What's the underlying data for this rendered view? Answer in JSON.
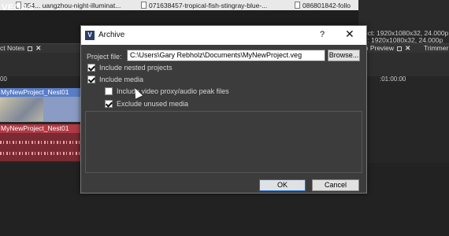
{
  "app": {
    "logo": "VEGAS"
  },
  "file_tabs": [
    {
      "label": "054... uangzhou-night-illuminat..."
    },
    {
      "label": "071638457-tropical-fish-stingray-blue-..."
    },
    {
      "label": "086801842-follo"
    }
  ],
  "properties": {
    "line1": "ect:   1920x1080x32, 24.000p",
    "line2": "lt:    1920x1080x32, 24.000p"
  },
  "panels": {
    "left_tab": "ct Notes",
    "right_tab": "eo Preview",
    "trimmer_tab": "Trimmer"
  },
  "timeline": {
    "timecode_left": "00",
    "timecode_right": ":01:00:00",
    "video_clip": "MyNewProject_Nest01",
    "audio_clip": "MyNewProject_Nest01"
  },
  "dialog": {
    "title": "Archive",
    "help": "?",
    "close": "✕",
    "project_file_label": "Project file:",
    "project_file_value": "C:\\Users\\Gary Rebholz\\Documents\\MyNewProject.veg",
    "browse_label": "Browse...",
    "options": [
      {
        "label": "Include nested projects",
        "checked": true
      },
      {
        "label": "Include media",
        "checked": true
      },
      {
        "label": "Include video proxy/audio peak files",
        "checked": false
      },
      {
        "label": "Exclude unused media",
        "checked": true
      }
    ],
    "ok_label": "OK",
    "cancel_label": "Cancel"
  }
}
